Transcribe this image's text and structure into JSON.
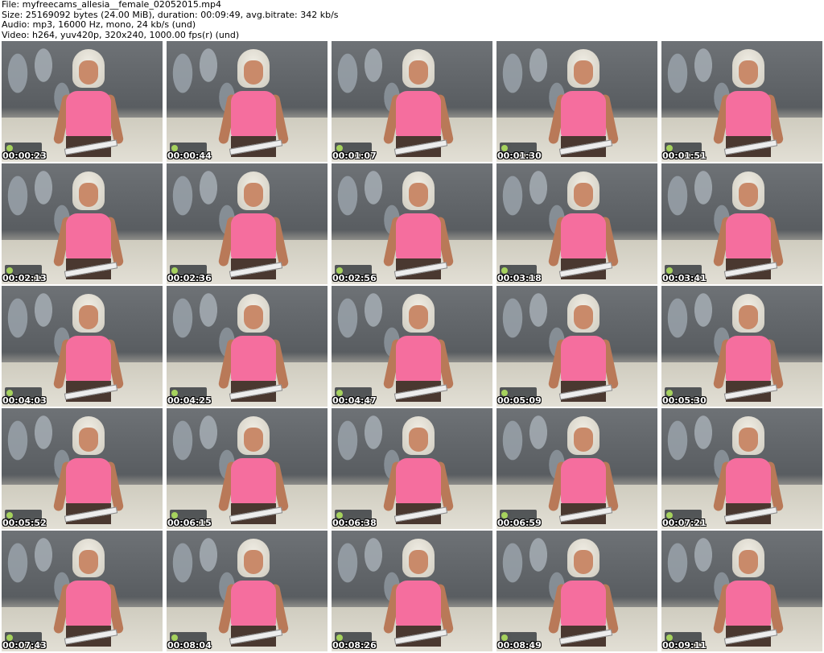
{
  "header": {
    "file_line": "File: myfreecams_allesia__female_02052015.mp4",
    "size_line": "Size: 25169092 bytes (24.00 MiB), duration: 00:09:49, avg.bitrate: 342 kb/s",
    "audio_line": "Audio: mp3, 16000 Hz, mono, 24 kb/s (und)",
    "video_line": "Video: h264, yuv420p, 320x240, 1000.00 fps(r) (und)"
  },
  "thumbnails": [
    {
      "timestamp": "00:00:23"
    },
    {
      "timestamp": "00:00:44"
    },
    {
      "timestamp": "00:01:07"
    },
    {
      "timestamp": "00:01:30"
    },
    {
      "timestamp": "00:01:51"
    },
    {
      "timestamp": "00:02:13"
    },
    {
      "timestamp": "00:02:36"
    },
    {
      "timestamp": "00:02:56"
    },
    {
      "timestamp": "00:03:18"
    },
    {
      "timestamp": "00:03:41"
    },
    {
      "timestamp": "00:04:03"
    },
    {
      "timestamp": "00:04:25"
    },
    {
      "timestamp": "00:04:47"
    },
    {
      "timestamp": "00:05:09"
    },
    {
      "timestamp": "00:05:30"
    },
    {
      "timestamp": "00:05:52"
    },
    {
      "timestamp": "00:06:15"
    },
    {
      "timestamp": "00:06:38"
    },
    {
      "timestamp": "00:06:59"
    },
    {
      "timestamp": "00:07:21"
    },
    {
      "timestamp": "00:07:43"
    },
    {
      "timestamp": "00:08:04"
    },
    {
      "timestamp": "00:08:26"
    },
    {
      "timestamp": "00:08:49"
    },
    {
      "timestamp": "00:09:11"
    }
  ],
  "colors": {
    "background": "#ffffff",
    "top_pink": "#f56e9e",
    "timestamp_text": "#ffffff"
  }
}
